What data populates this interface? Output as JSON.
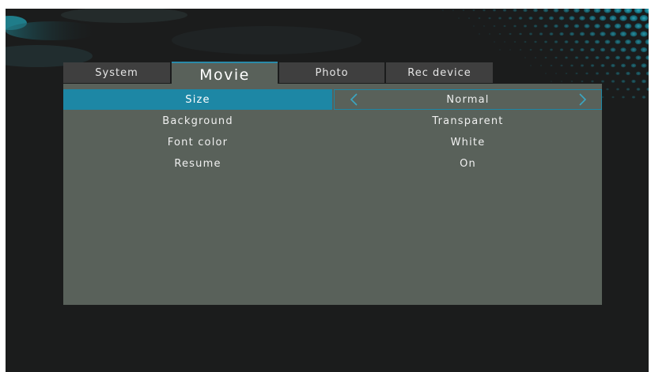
{
  "tabs": [
    {
      "label": "System",
      "active": false
    },
    {
      "label": "Movie",
      "active": true
    },
    {
      "label": "Photo",
      "active": false
    },
    {
      "label": "Rec device",
      "active": false
    }
  ],
  "settings": [
    {
      "label": "Size",
      "value": "Normal",
      "selected": true
    },
    {
      "label": "Background",
      "value": "Transparent",
      "selected": false
    },
    {
      "label": "Font color",
      "value": "White",
      "selected": false
    },
    {
      "label": "Resume",
      "value": "On",
      "selected": false
    }
  ],
  "icons": {
    "prev": "chevron-left-icon",
    "next": "chevron-right-icon"
  },
  "colors": {
    "accent": "#1d87a5",
    "panel": "#59615a",
    "background": "#1b1c1c",
    "tab_inactive": "#3f3f3f"
  }
}
